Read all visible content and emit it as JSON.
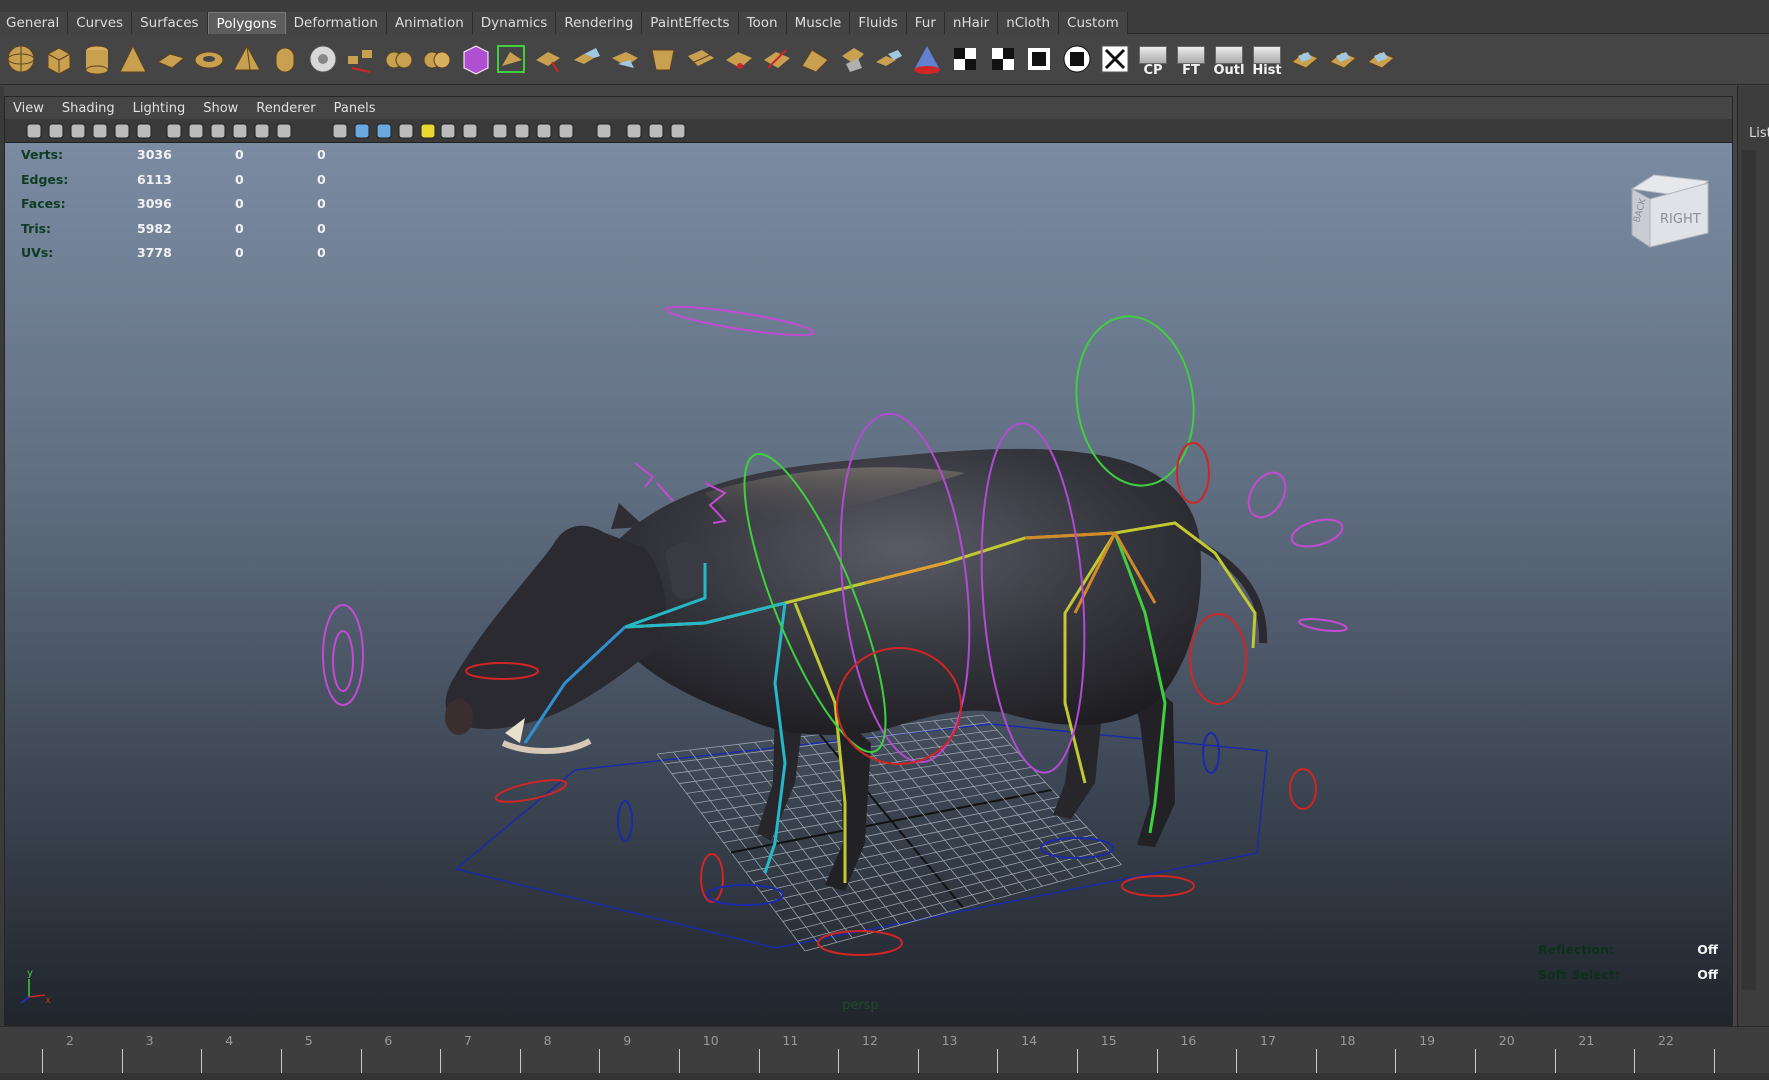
{
  "shelf_tabs": [
    {
      "label": "General",
      "active": false
    },
    {
      "label": "Curves",
      "active": false
    },
    {
      "label": "Surfaces",
      "active": false
    },
    {
      "label": "Polygons",
      "active": true
    },
    {
      "label": "Deformation",
      "active": false
    },
    {
      "label": "Animation",
      "active": false
    },
    {
      "label": "Dynamics",
      "active": false
    },
    {
      "label": "Rendering",
      "active": false
    },
    {
      "label": "PaintEffects",
      "active": false
    },
    {
      "label": "Toon",
      "active": false
    },
    {
      "label": "Muscle",
      "active": false
    },
    {
      "label": "Fluids",
      "active": false
    },
    {
      "label": "Fur",
      "active": false
    },
    {
      "label": "nHair",
      "active": false
    },
    {
      "label": "nCloth",
      "active": false
    },
    {
      "label": "Custom",
      "active": false
    }
  ],
  "shelf_icons": [
    "poly-sphere-icon",
    "poly-cube-icon",
    "poly-cylinder-icon",
    "poly-cone-icon",
    "poly-plane-icon",
    "poly-torus-icon",
    "poly-pyramid-icon",
    "poly-pipe-icon",
    "poly-soccer-ball-icon",
    "separate-icon",
    "combine-icon",
    "smooth-icon",
    "highlighted-cube-icon",
    "extrude-face-icon",
    "select-edge-loop-icon",
    "bridge-icon",
    "append-polygon-icon",
    "bevel-icon",
    "split-polygon-icon",
    "insert-edge-loop-icon",
    "merge-vertex-icon",
    "wedge-icon",
    "poke-icon",
    "duplicate-face-icon",
    "mirror-icon",
    "checker-uv-icon",
    "checker-uv-2-icon",
    "checker-uv-3-icon",
    "uv-editor-icon",
    "uv-grid-icon",
    "center-pivot-icon",
    "freeze-transform-icon"
  ],
  "shelf_text_icons": [
    {
      "label": "CP"
    },
    {
      "label": "FT"
    },
    {
      "label": "Outl"
    },
    {
      "label": "Hist"
    }
  ],
  "panel_menu": [
    "View",
    "Shading",
    "Lighting",
    "Show",
    "Renderer",
    "Panels"
  ],
  "hud_poly": {
    "rows": [
      {
        "label": "Verts:",
        "values": [
          "3036",
          "0",
          "0"
        ]
      },
      {
        "label": "Edges:",
        "values": [
          "6113",
          "0",
          "0"
        ]
      },
      {
        "label": "Faces:",
        "values": [
          "3096",
          "0",
          "0"
        ]
      },
      {
        "label": "Tris:",
        "values": [
          "5982",
          "0",
          "0"
        ]
      },
      {
        "label": "UVs:",
        "values": [
          "3778",
          "0",
          "0"
        ]
      }
    ]
  },
  "hud_right": {
    "rows": [
      {
        "label": "Reflection:",
        "value": "Off"
      },
      {
        "label": "Soft Select:",
        "value": "Off"
      }
    ]
  },
  "camera_label": "persp",
  "viewcube": {
    "face_label": "RIGHT",
    "side_label": "BACK"
  },
  "axis": {
    "y": "y",
    "x": "x"
  },
  "right_panel": {
    "label": "List"
  },
  "timeline": {
    "ticks": [
      "2",
      "3",
      "4",
      "5",
      "6",
      "7",
      "8",
      "9",
      "10",
      "11",
      "12",
      "13",
      "14",
      "15",
      "16",
      "17",
      "18",
      "19",
      "20",
      "21",
      "22"
    ]
  },
  "colors": {
    "viewport_top": "#7a8ba2",
    "viewport_bottom": "#20252c",
    "hud_label": "#0f3b22",
    "boar_body": "#2f2f36",
    "ctrl_magenta": "#c24bd2",
    "ctrl_green": "#3fcf3f",
    "ctrl_red": "#d02525",
    "ctrl_blue": "#2030b0",
    "joint_orange": "#d08a2a",
    "joint_cyan": "#25b8c8"
  }
}
